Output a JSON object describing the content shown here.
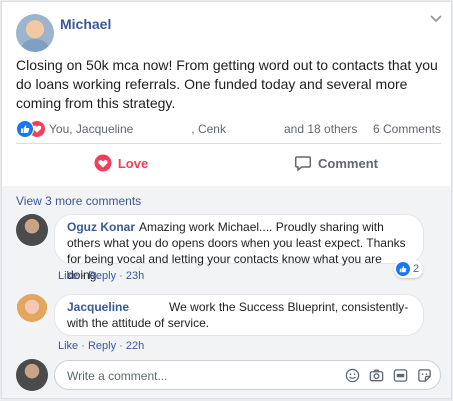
{
  "post": {
    "author": "Michael",
    "text": "Closing on 50k mca now! From getting word out to contacts that you do loans working referrals. One funded today and several more coming from this strategy.",
    "reactions": {
      "names_part1": "You, Jacqueline",
      "names_part2": ", Cenk",
      "names_part3": "and 18 others",
      "comments_count": "6 Comments",
      "icons": [
        "like-icon",
        "love-icon"
      ]
    },
    "actions": {
      "love_label": "Love",
      "comment_label": "Comment"
    }
  },
  "comments": {
    "view_more": "View 3 more comments",
    "items": [
      {
        "author": "Oguz Konar",
        "text": "Amazing work Michael.... Proudly sharing with others what you do opens doors when you least expect. Thanks for being vocal and letting your contacts know what you are doing.",
        "like": "Like",
        "reply": "Reply",
        "time": "23h",
        "reaction_count": "2"
      },
      {
        "author": "Jacqueline",
        "text": "We work the Success Blueprint, consistently- with the attitude of service.",
        "like": "Like",
        "reply": "Reply",
        "time": "22h"
      }
    ]
  },
  "composer": {
    "placeholder": "Write a comment...",
    "tools": [
      "emoji-icon",
      "camera-icon",
      "gif-icon",
      "sticker-icon"
    ]
  },
  "separator": "·",
  "colors": {
    "link": "#385898",
    "love": "#f33e58",
    "like": "#1877f2",
    "muted": "#606770"
  }
}
